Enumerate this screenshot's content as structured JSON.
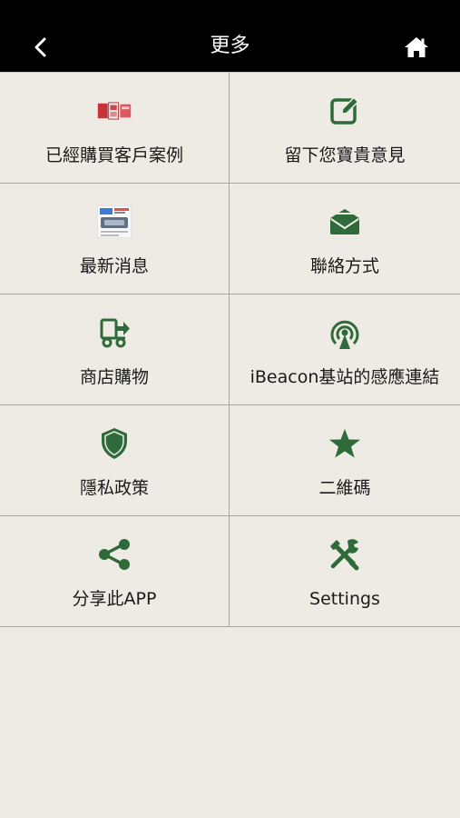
{
  "header": {
    "title": "更多"
  },
  "menu": [
    {
      "label": "已經購買客戶案例",
      "icon": "customer-case-thumbnail-icon"
    },
    {
      "label": "留下您寶貴意見",
      "icon": "edit-icon"
    },
    {
      "label": "最新消息",
      "icon": "news-thumbnail-icon"
    },
    {
      "label": "聯絡方式",
      "icon": "mail-icon"
    },
    {
      "label": "商店購物",
      "icon": "delivery-truck-icon"
    },
    {
      "label": "iBeacon基站的感應連結",
      "icon": "broadcast-icon"
    },
    {
      "label": "隱私政策",
      "icon": "shield-icon"
    },
    {
      "label": "二維碼",
      "icon": "star-icon"
    },
    {
      "label": "分享此APP",
      "icon": "share-icon"
    },
    {
      "label": "Settings",
      "icon": "tools-icon"
    }
  ],
  "colors": {
    "accent": "#2F6B3A",
    "background": "#EEEBE4",
    "header": "#000000"
  }
}
